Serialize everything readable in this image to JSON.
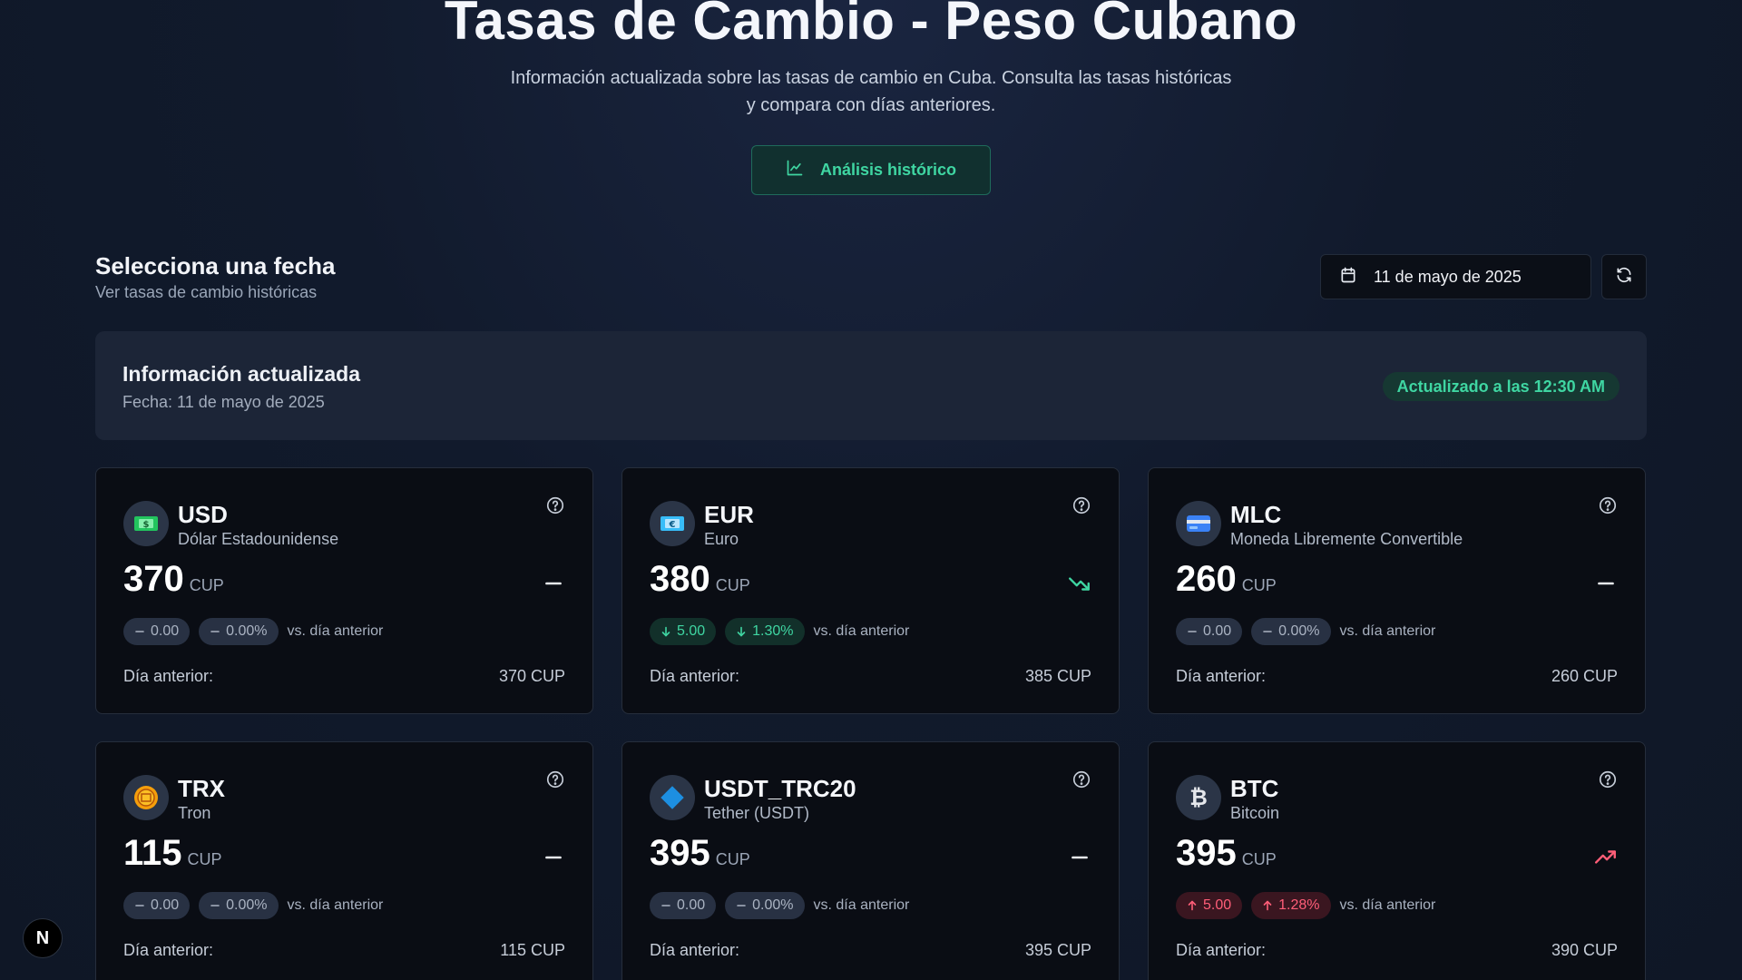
{
  "hero": {
    "title": "Tasas de Cambio - Peso Cubano",
    "subtitle": "Información actualizada sobre las tasas de cambio en Cuba. Consulta las tasas históricas y compara con días anteriores.",
    "history_button": "Análisis histórico"
  },
  "selector": {
    "title": "Selecciona una fecha",
    "subtitle": "Ver tasas de cambio históricas",
    "date": "11 de mayo de 2025"
  },
  "info": {
    "title": "Información actualizada",
    "date": "Fecha: 11 de mayo de 2025",
    "badge": "Actualizado a las 12:30 AM"
  },
  "common": {
    "unit": "CUP",
    "vs_label": "vs. día anterior",
    "prev_label": "Día anterior:"
  },
  "cards": [
    {
      "code": "USD",
      "name": "Dólar Estadounidense",
      "value": "370",
      "trend": "flat",
      "change": "0.00",
      "pct": "0.00%",
      "prev": "370 CUP",
      "icon": "dollar-bill-icon"
    },
    {
      "code": "EUR",
      "name": "Euro",
      "value": "380",
      "trend": "down",
      "change": "5.00",
      "pct": "1.30%",
      "prev": "385 CUP",
      "icon": "euro-bill-icon"
    },
    {
      "code": "MLC",
      "name": "Moneda Libremente Convertible",
      "value": "260",
      "trend": "flat",
      "change": "0.00",
      "pct": "0.00%",
      "prev": "260 CUP",
      "icon": "credit-card-icon"
    },
    {
      "code": "TRX",
      "name": "Tron",
      "value": "115",
      "trend": "flat",
      "change": "0.00",
      "pct": "0.00%",
      "prev": "115 CUP",
      "icon": "coin-icon"
    },
    {
      "code": "USDT_TRC20",
      "name": "Tether (USDT)",
      "value": "395",
      "trend": "flat",
      "change": "0.00",
      "pct": "0.00%",
      "prev": "395 CUP",
      "icon": "diamond-icon"
    },
    {
      "code": "BTC",
      "name": "Bitcoin",
      "value": "395",
      "trend": "up",
      "change": "5.00",
      "pct": "1.28%",
      "prev": "390 CUP",
      "icon": "bitcoin-icon"
    }
  ],
  "colors": {
    "accent": "#3fd6a2",
    "down": "#3fd6a2",
    "up": "#ff5e78",
    "card_bg": "#0a0d14",
    "page_bg": "#111a2c"
  },
  "dev_badge": "N"
}
